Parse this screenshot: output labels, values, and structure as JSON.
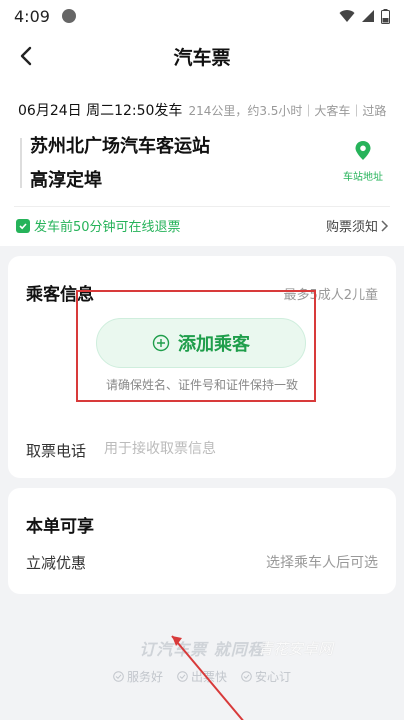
{
  "status": {
    "time": "4:09"
  },
  "nav": {
    "title": "汽车票"
  },
  "trip": {
    "departure": "06月24日 周二12:50发车",
    "meta": "214公里，约3.5小时｜大客车｜过路",
    "from": "苏州北广场汽车客运站",
    "to": "高淳定埠",
    "station_address_label": "车站地址",
    "refund_note": "发车前50分钟可在线退票",
    "purchase_notice": "购票须知"
  },
  "passenger": {
    "heading": "乘客信息",
    "limit": "最多5成人2儿童",
    "add_label": "添加乘客",
    "hint": "请确保姓名、证件号和证件保持一致",
    "phone_label": "取票电话",
    "phone_placeholder": "用于接收取票信息"
  },
  "discount": {
    "heading": "本单可享",
    "item_label": "立减优惠",
    "item_value": "选择乘车人后可选"
  },
  "footer": {
    "slogan": "订汽车票 就同程",
    "watermark": "青花安卓网",
    "features": [
      "服务好",
      "出票快",
      "安心订"
    ]
  },
  "colors": {
    "accent": "#26b35a",
    "highlight": "#d83a3a"
  }
}
